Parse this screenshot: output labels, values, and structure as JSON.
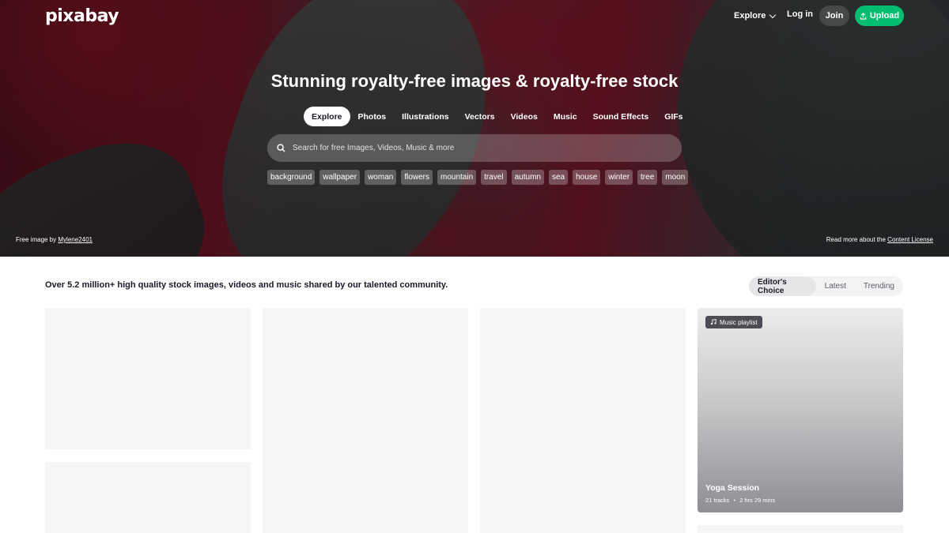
{
  "header": {
    "logo": "pixabay",
    "explore_label": "Explore",
    "login_label": "Log in",
    "join_label": "Join",
    "upload_label": "Upload"
  },
  "hero": {
    "title": "Stunning royalty-free images & royalty-free stock",
    "tabs": [
      {
        "label": "Explore",
        "active": true
      },
      {
        "label": "Photos"
      },
      {
        "label": "Illustrations"
      },
      {
        "label": "Vectors"
      },
      {
        "label": "Videos"
      },
      {
        "label": "Music"
      },
      {
        "label": "Sound Effects"
      },
      {
        "label": "GIFs"
      }
    ],
    "search_placeholder": "Search for free Images, Videos, Music & more",
    "tags": [
      "background",
      "wallpaper",
      "woman",
      "flowers",
      "mountain",
      "travel",
      "autumn",
      "sea",
      "house",
      "winter",
      "tree",
      "moon"
    ],
    "credit_prefix": "Free image by",
    "credit_user": "Mylene2401",
    "license_prefix": "Read more about the",
    "license_link": "Content License"
  },
  "main": {
    "tagline": "Over 5.2 million+ high quality stock images, videos and music shared by our talented community.",
    "sort": [
      {
        "label": "Editor's Choice",
        "active": true
      },
      {
        "label": "Latest"
      },
      {
        "label": "Trending"
      }
    ],
    "playlist": {
      "badge": "Music playlist",
      "title": "Yoga Session",
      "tracks": "21 tracks",
      "separator": "•",
      "duration": "2 hrs 29 mins"
    }
  },
  "colors": {
    "accent": "#02be6e",
    "text": "#191b26",
    "placeholder_tile": "#f5f5f5"
  },
  "icons": [
    "search-icon",
    "chevron-down-icon",
    "upload-icon",
    "music-note-icon"
  ]
}
